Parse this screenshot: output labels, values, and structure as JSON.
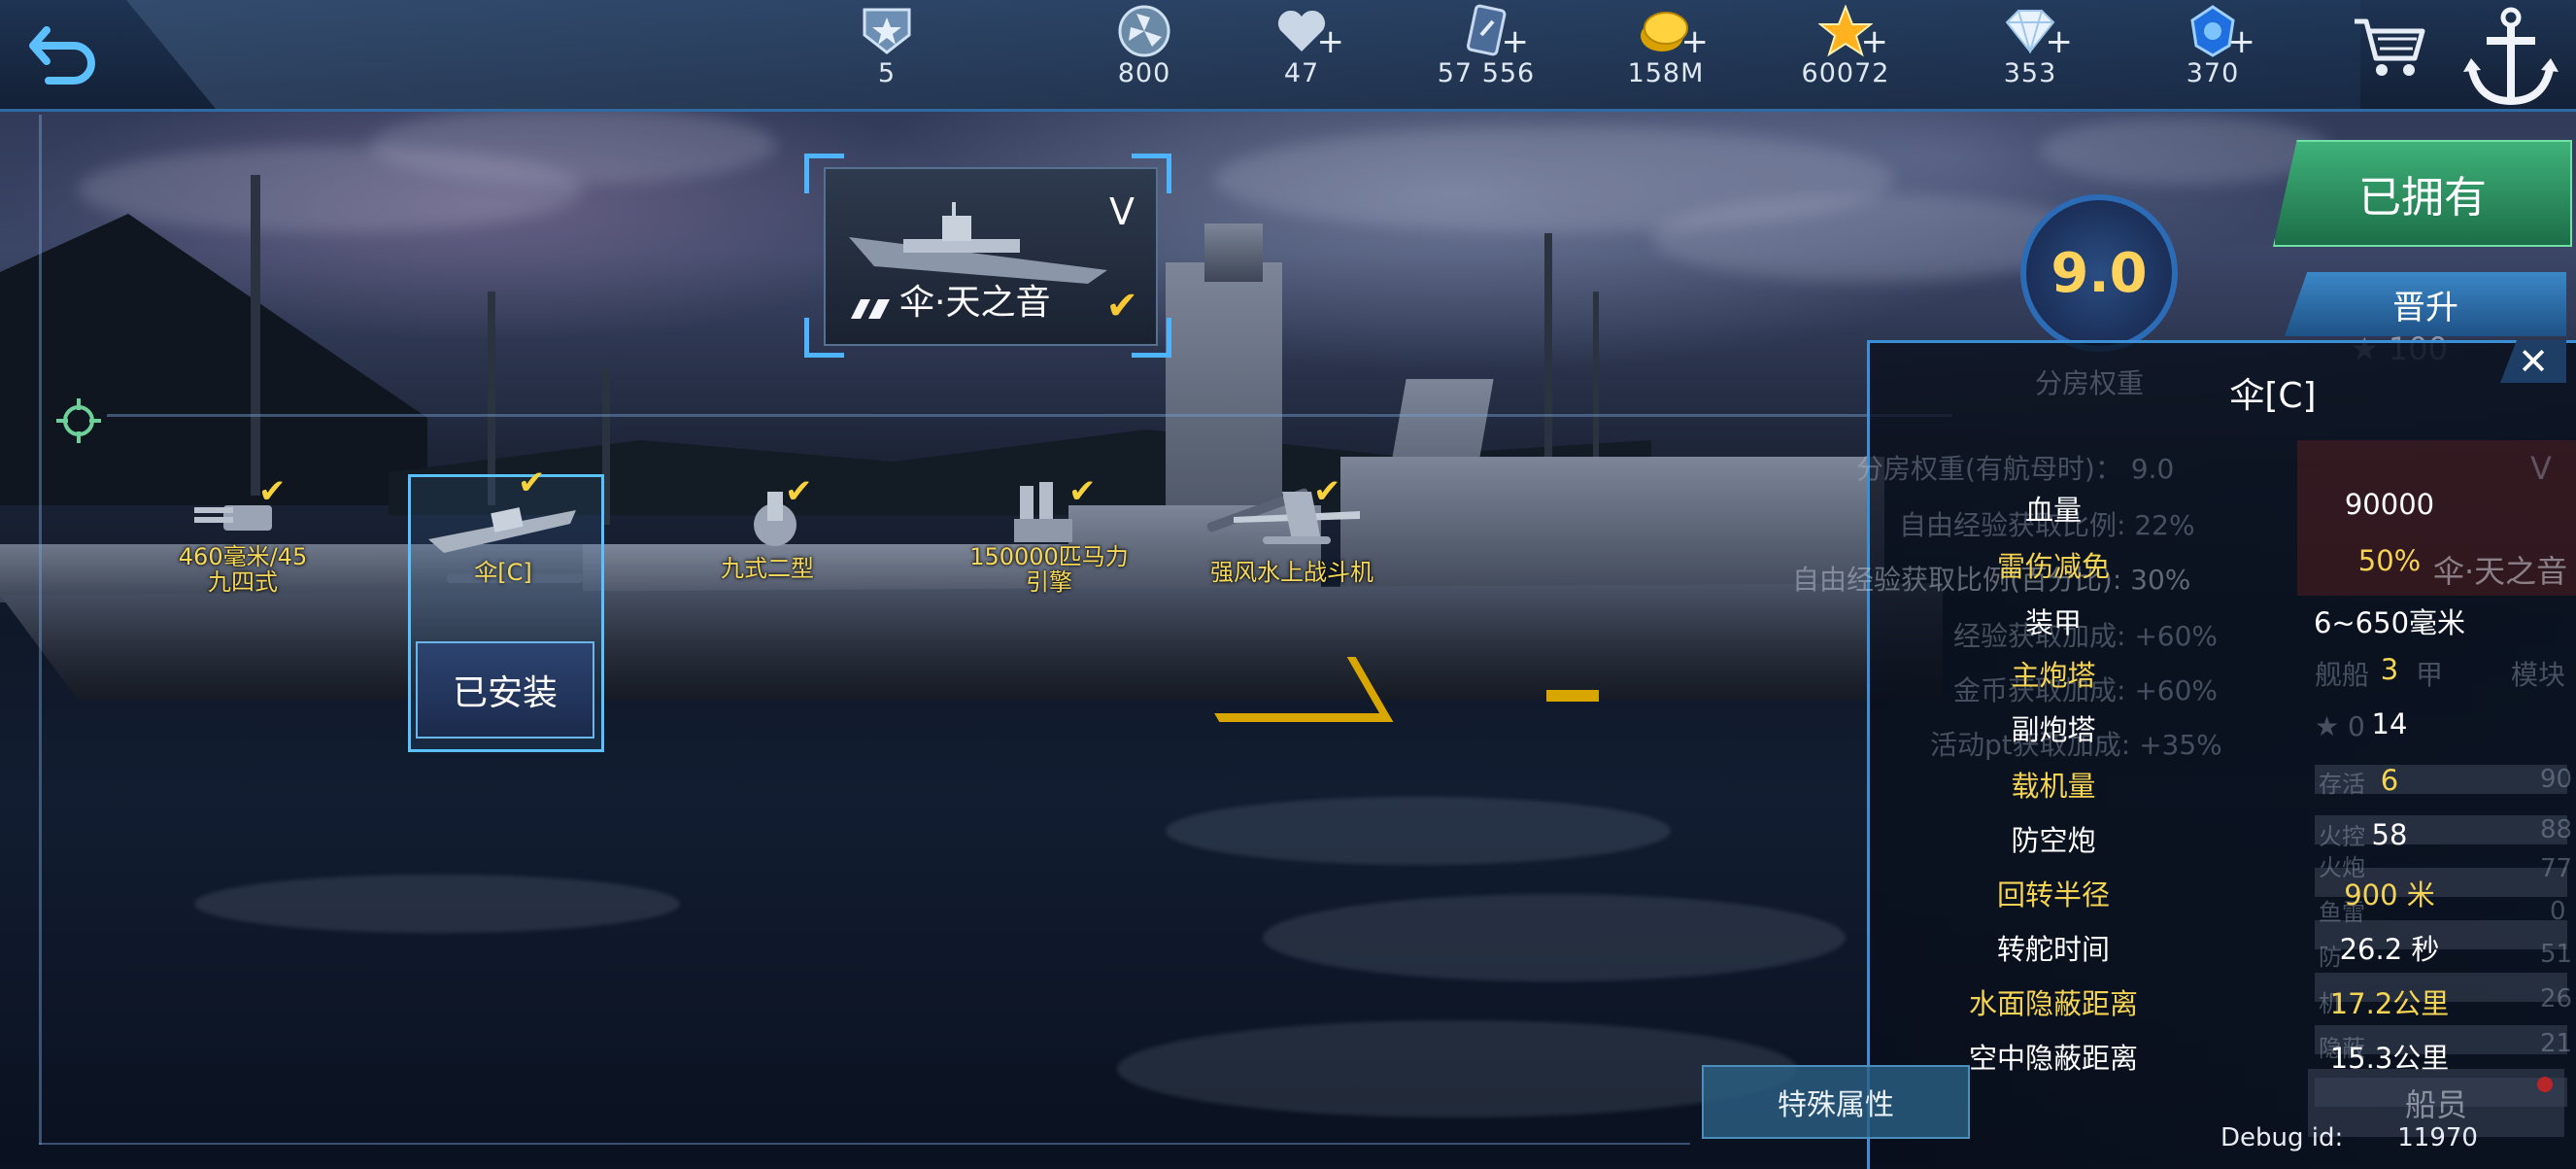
{
  "topbar": {
    "back_icon": "back-arrow-icon",
    "resources": [
      {
        "name": "rank",
        "icon": "rank-badge-icon",
        "value": "5",
        "plus": false
      },
      {
        "name": "fuel",
        "icon": "propeller-token-icon",
        "value": "800",
        "plus": false
      },
      {
        "name": "stamina",
        "icon": "heart-icon",
        "value": "47",
        "plus": true
      },
      {
        "name": "cards",
        "icon": "card-icon",
        "value": "57 556",
        "plus": true
      },
      {
        "name": "gold",
        "icon": "gold-coin-icon",
        "value": "158M",
        "plus": true
      },
      {
        "name": "stars",
        "icon": "star-icon",
        "value": "60072",
        "plus": true
      },
      {
        "name": "diamonds",
        "icon": "diamond-icon",
        "value": "353",
        "plus": true
      },
      {
        "name": "vip",
        "icon": "vip-gem-icon",
        "value": "370",
        "plus": true
      }
    ],
    "shop_icon": "shopping-cart-icon",
    "port_icon": "anchor-icon"
  },
  "ship_card": {
    "grade": "V",
    "name": "伞·天之音",
    "status_icon": "check-icon"
  },
  "modules": [
    {
      "id": "main-gun",
      "label": "460毫米/45\n九四式",
      "installed": true
    },
    {
      "id": "hull",
      "label": "伞[C]",
      "installed": true,
      "selected": true
    },
    {
      "id": "secondary",
      "label": "九式二型",
      "installed": true
    },
    {
      "id": "engine",
      "label": "150000匹马力\n引擎",
      "installed": true
    },
    {
      "id": "aircraft",
      "label": "强风水上战斗机",
      "installed": true
    }
  ],
  "installed_button": "已安装",
  "rating": "9.0",
  "owned_button": "已拥有",
  "promote_button": "晋升",
  "promote_cost": "100",
  "panel": {
    "title": "伞[C]",
    "close_icon": "close-x-icon",
    "ghost_header": "分房权重",
    "ghost_lines": [
      "分房权重(有航母时)： 9.0",
      "自由经验获取比例: 22%",
      "自由经验获取比例(百分比): 30%",
      "经验获取加成: +60%",
      "金币获取加成: +60%",
      "活动pt获取加成: +35%"
    ],
    "stats": [
      {
        "label": "血量",
        "value": "90000",
        "label_color": "white",
        "value_color": "white"
      },
      {
        "label": "雷伤减免",
        "value": "50%",
        "label_color": "gold",
        "value_color": "gold"
      },
      {
        "label": "装甲",
        "value": "6~650毫米",
        "label_color": "white",
        "value_color": "white"
      },
      {
        "label": "主炮塔",
        "value": "3",
        "label_color": "gold",
        "value_color": "gold"
      },
      {
        "label": "副炮塔",
        "value": "14",
        "label_color": "white",
        "value_color": "white"
      },
      {
        "label": "载机量",
        "value": "6",
        "label_color": "gold",
        "value_color": "gold"
      },
      {
        "label": "防空炮",
        "value": "58",
        "label_color": "white",
        "value_color": "white"
      },
      {
        "label": "回转半径",
        "value": "900 米",
        "label_color": "gold",
        "value_color": "gold"
      },
      {
        "label": "转舵时间",
        "value": "26.2 秒",
        "label_color": "white",
        "value_color": "white"
      },
      {
        "label": "水面隐蔽距离",
        "value": "17.2公里",
        "label_color": "gold",
        "value_color": "gold"
      },
      {
        "label": "空中隐蔽距离",
        "value": "15.3公里",
        "label_color": "white",
        "value_color": "white"
      }
    ],
    "bg_card": {
      "grade": "V",
      "name": "伞·天之音",
      "tabs": [
        "舰船",
        "甲",
        "模块"
      ],
      "star_value": "0",
      "attributes": [
        {
          "label": "存活",
          "value": "90"
        },
        {
          "label": "火控",
          "value": "88"
        },
        {
          "label": "火炮",
          "value": "77"
        },
        {
          "label": "鱼雷",
          "value": "0"
        },
        {
          "label": "防",
          "value": "51"
        },
        {
          "label": "机",
          "value": "26"
        },
        {
          "label": "隐蔽",
          "value": "21"
        }
      ]
    }
  },
  "special_button": "特殊属性",
  "crew_button": "船员",
  "debug": {
    "label": "Debug id:",
    "value": "11970"
  }
}
